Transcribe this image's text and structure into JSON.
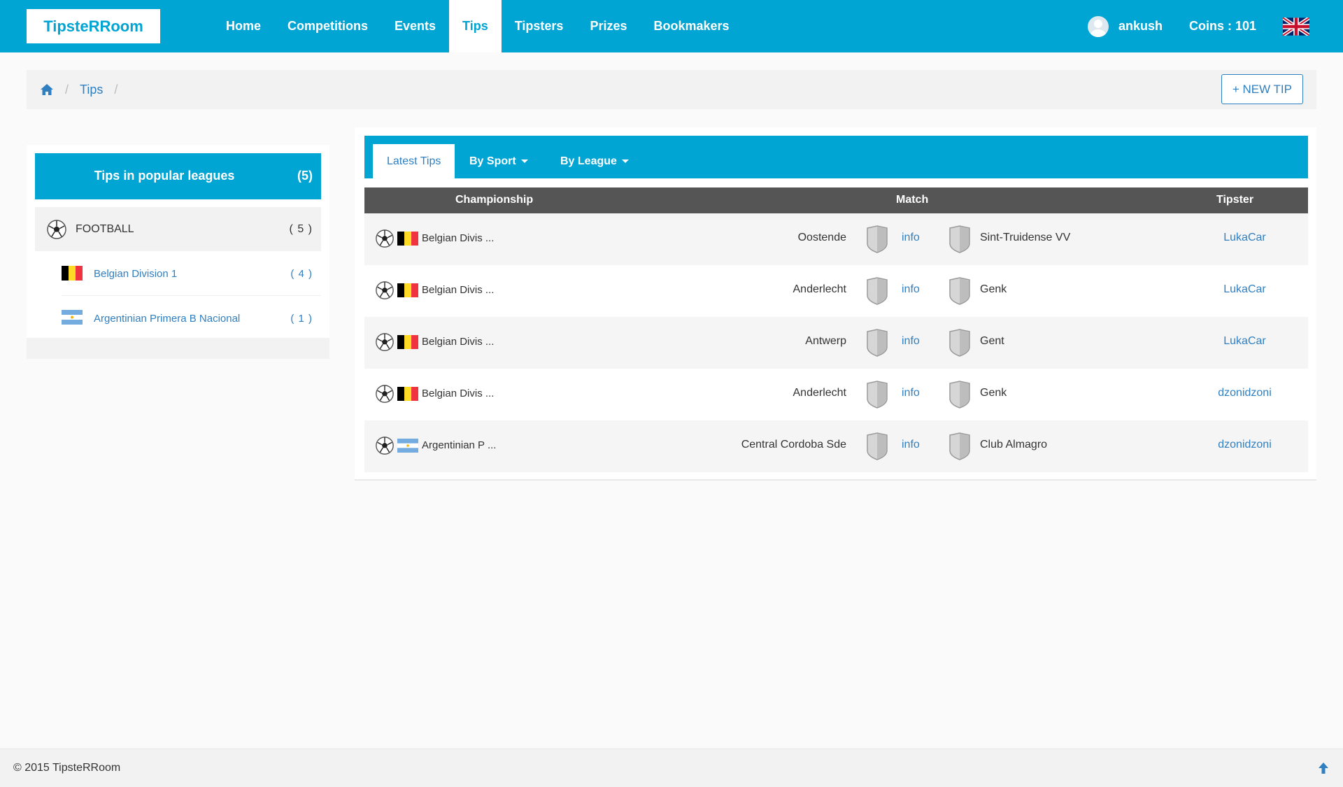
{
  "brand": "TipsteRRoom",
  "nav": {
    "items": [
      "Home",
      "Competitions",
      "Events",
      "Tips",
      "Tipsters",
      "Prizes",
      "Bookmakers"
    ],
    "active": "Tips",
    "user": "ankush",
    "coins": "Coins : 101",
    "language_icon": "uk-flag-icon"
  },
  "breadcrumb": {
    "current": "Tips",
    "separator": "/"
  },
  "new_tip_label": "+ NEW TIP",
  "sidebar": {
    "title": "Tips in popular leagues",
    "count": "(5)",
    "sport": {
      "label": "FOOTBALL",
      "count": "( 5 )"
    },
    "leagues": [
      {
        "name": "Belgian Division 1",
        "count": "( 4 )",
        "flag": "belgium"
      },
      {
        "name": "Argentinian Primera B Nacional",
        "count": "( 1 )",
        "flag": "argentina"
      }
    ]
  },
  "tabs": {
    "latest": "Latest Tips",
    "sport": "By Sport",
    "league": "By League"
  },
  "table": {
    "headers": {
      "championship": "Championship",
      "match": "Match",
      "tipster": "Tipster"
    },
    "info_label": "info",
    "rows": [
      {
        "championship": "Belgian Divis ...",
        "flag": "belgium",
        "home": "Oostende",
        "away": "Sint-Truidense VV",
        "tipster": "LukaCar"
      },
      {
        "championship": "Belgian Divis ...",
        "flag": "belgium",
        "home": "Anderlecht",
        "away": "Genk",
        "tipster": "LukaCar"
      },
      {
        "championship": "Belgian Divis ...",
        "flag": "belgium",
        "home": "Antwerp",
        "away": "Gent",
        "tipster": "LukaCar"
      },
      {
        "championship": "Belgian Divis ...",
        "flag": "belgium",
        "home": "Anderlecht",
        "away": "Genk",
        "tipster": "dzonidzoni"
      },
      {
        "championship": "Argentinian P ...",
        "flag": "argentina",
        "home": "Central Cordoba Sde",
        "away": "Club Almagro",
        "tipster": "dzonidzoni"
      }
    ]
  },
  "footer": {
    "copyright": "© 2015 TipsteRRoom"
  },
  "colors": {
    "primary": "#00a5d4",
    "link": "#2f7fc1",
    "table_header": "#555555"
  }
}
